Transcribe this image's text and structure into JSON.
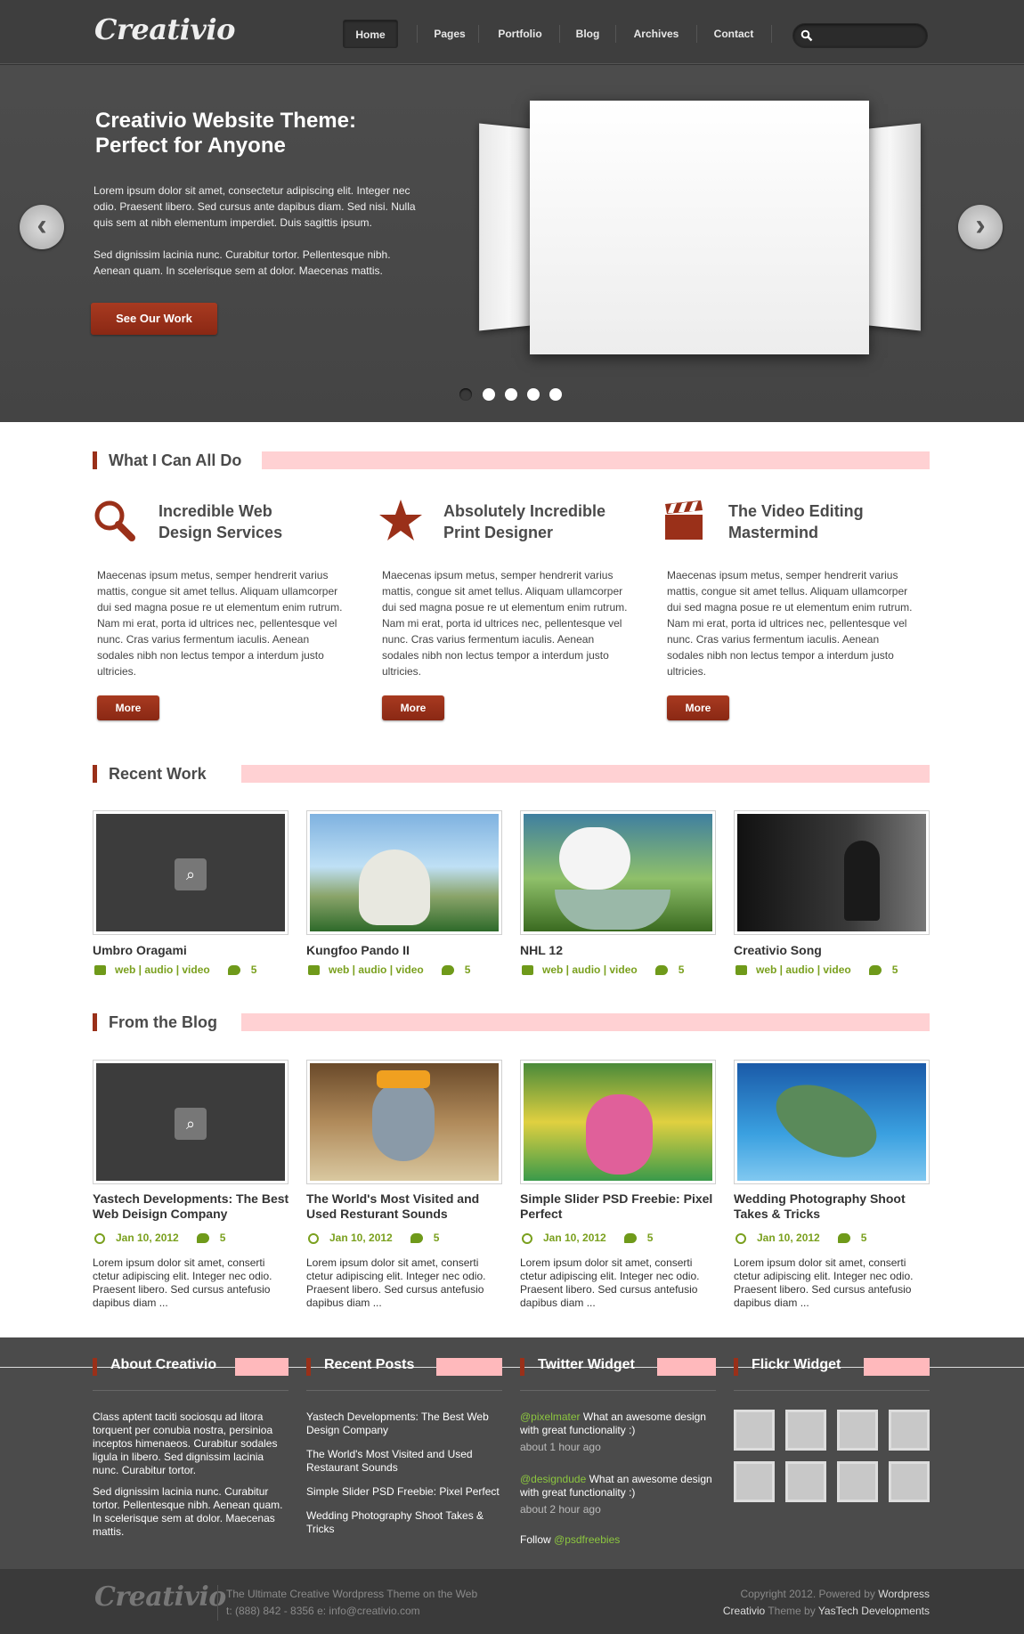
{
  "header": {
    "logo": "Creativio",
    "nav": [
      "Home",
      "Pages",
      "Portfolio",
      "Blog",
      "Archives",
      "Contact"
    ],
    "search_placeholder": ""
  },
  "hero": {
    "title": "Creativio Website Theme: Perfect for Anyone",
    "para1": "Lorem ipsum dolor sit amet, consectetur adipiscing elit. Integer nec odio. Praesent libero. Sed cursus ante dapibus diam. Sed nisi. Nulla quis sem at nibh elementum imperdiet. Duis sagittis ipsum.",
    "para2": "Sed dignissim lacinia nunc. Curabitur tortor. Pellentesque nibh. Aenean quam. In scelerisque sem at dolor. Maecenas mattis.",
    "cta": "See Our Work",
    "prev_icon": "chevron-left-icon",
    "next_icon": "chevron-right-icon",
    "slides_total": 5,
    "active_slide": 1
  },
  "services": {
    "heading": "What I Can All Do",
    "items": [
      {
        "icon": "magnifier-icon",
        "title": "Incredible Web Design Services",
        "text": "Maecenas ipsum metus, semper hendrerit varius mattis, congue sit amet tellus. Aliquam ullamcorper dui sed magna posue re ut elementum enim rutrum. Nam mi erat, porta id ultrices nec, pellentesque vel nunc. Cras varius fermentum iaculis. Aenean sodales nibh non lectus tempor a interdum justo ultricies.",
        "button": "More"
      },
      {
        "icon": "star-icon",
        "title": "Absolutely Incredible Print Designer",
        "text": "Maecenas ipsum metus, semper hendrerit varius mattis, congue sit amet tellus. Aliquam ullamcorper dui sed magna posue re ut elementum enim rutrum. Nam mi erat, porta id ultrices nec, pellentesque vel nunc. Cras varius fermentum iaculis. Aenean sodales nibh non lectus tempor a interdum justo ultricies.",
        "button": "More"
      },
      {
        "icon": "clapperboard-icon",
        "title": "The Video Editing Mastermind",
        "text": "Maecenas ipsum metus, semper hendrerit varius mattis, congue sit amet tellus. Aliquam ullamcorper dui sed magna posue re ut elementum enim rutrum. Nam mi erat, porta id ultrices nec, pellentesque vel nunc. Cras varius fermentum iaculis. Aenean sodales nibh non lectus tempor a interdum justo ultricies.",
        "button": "More"
      }
    ]
  },
  "recent_work": {
    "heading": "Recent Work",
    "items": [
      {
        "title": "Umbro Oragami",
        "tags": "web | audio | video",
        "comments": "5"
      },
      {
        "title": "Kungfoo Pando II",
        "tags": "web | audio | video",
        "comments": "5"
      },
      {
        "title": "NHL 12",
        "tags": "web | audio | video",
        "comments": "5"
      },
      {
        "title": "Creativio Song",
        "tags": "web | audio | video",
        "comments": "5"
      }
    ]
  },
  "blog": {
    "heading": "From the Blog",
    "items": [
      {
        "title": "Yastech Developments: The Best Web Deisign Company",
        "date": "Jan 10, 2012",
        "comments": "5",
        "excerpt": "Lorem ipsum dolor sit amet, conserti ctetur adipiscing elit. Integer nec odio. Praesent libero. Sed cursus antefusio dapibus diam ..."
      },
      {
        "title": "The World's Most Visited and Used Resturant Sounds",
        "date": "Jan 10, 2012",
        "comments": "5",
        "excerpt": "Lorem ipsum dolor sit amet, conserti ctetur adipiscing elit. Integer nec odio. Praesent libero. Sed cursus antefusio dapibus diam ..."
      },
      {
        "title": "Simple Slider PSD Freebie: Pixel Perfect",
        "date": "Jan 10, 2012",
        "comments": "5",
        "excerpt": "Lorem ipsum dolor sit amet, conserti ctetur adipiscing elit. Integer nec odio. Praesent libero. Sed cursus antefusio dapibus diam ..."
      },
      {
        "title": "Wedding Photography Shoot Takes & Tricks",
        "date": "Jan 10, 2012",
        "comments": "5",
        "excerpt": "Lorem ipsum dolor sit amet, conserti ctetur adipiscing elit. Integer nec odio. Praesent libero. Sed cursus antefusio dapibus diam ..."
      }
    ]
  },
  "footer": {
    "about": {
      "heading": "About Creativio",
      "para1": "Class aptent taciti sociosqu ad litora torquent per conubia nostra, persinioa inceptos himenaeos. Curabitur sodales ligula in libero. Sed dignissim lacinia nunc. Curabitur tortor.",
      "para2": "Sed dignissim lacinia nunc. Curabitur tortor. Pellentesque nibh. Aenean quam. In scelerisque sem at dolor. Maecenas mattis."
    },
    "recent_posts": {
      "heading": "Recent Posts",
      "items": [
        "Yastech Developments: The Best Web Design Company",
        "The World's Most Visited and Used Restaurant Sounds",
        "Simple Slider PSD Freebie: Pixel Perfect",
        "Wedding Photography Shoot Takes & Tricks"
      ]
    },
    "twitter": {
      "heading": "Twitter Widget",
      "tweets": [
        {
          "user": "@pixelmater",
          "text": " What an awesome design with great functionality :)",
          "time": "about 1 hour ago"
        },
        {
          "user": "@designdude",
          "text": " What an awesome design with great functionality :)",
          "time": "about 2 hour ago"
        }
      ],
      "follow_label": "Follow ",
      "follow_handle": "@psdfreebies"
    },
    "flickr": {
      "heading": "Flickr Widget",
      "count": 8
    }
  },
  "bottom": {
    "logo": "Creativio",
    "tagline": "The Ultimate Creative Wordpress Theme on the Web",
    "contact": "t: (888) 842 - 8356  e: info@creativio.com",
    "copy_prefix": "Copyright 2012. Powered by ",
    "copy_link": "Wordpress",
    "theme_name": "Creativio",
    "theme_by": " Theme by ",
    "theme_author": "YasTech Developments"
  },
  "colors": {
    "accent": "#9a3019",
    "link_green": "#7aa01e",
    "highlight_pink": "#ffd1d3",
    "dark_bg": "#4b4b4b"
  }
}
